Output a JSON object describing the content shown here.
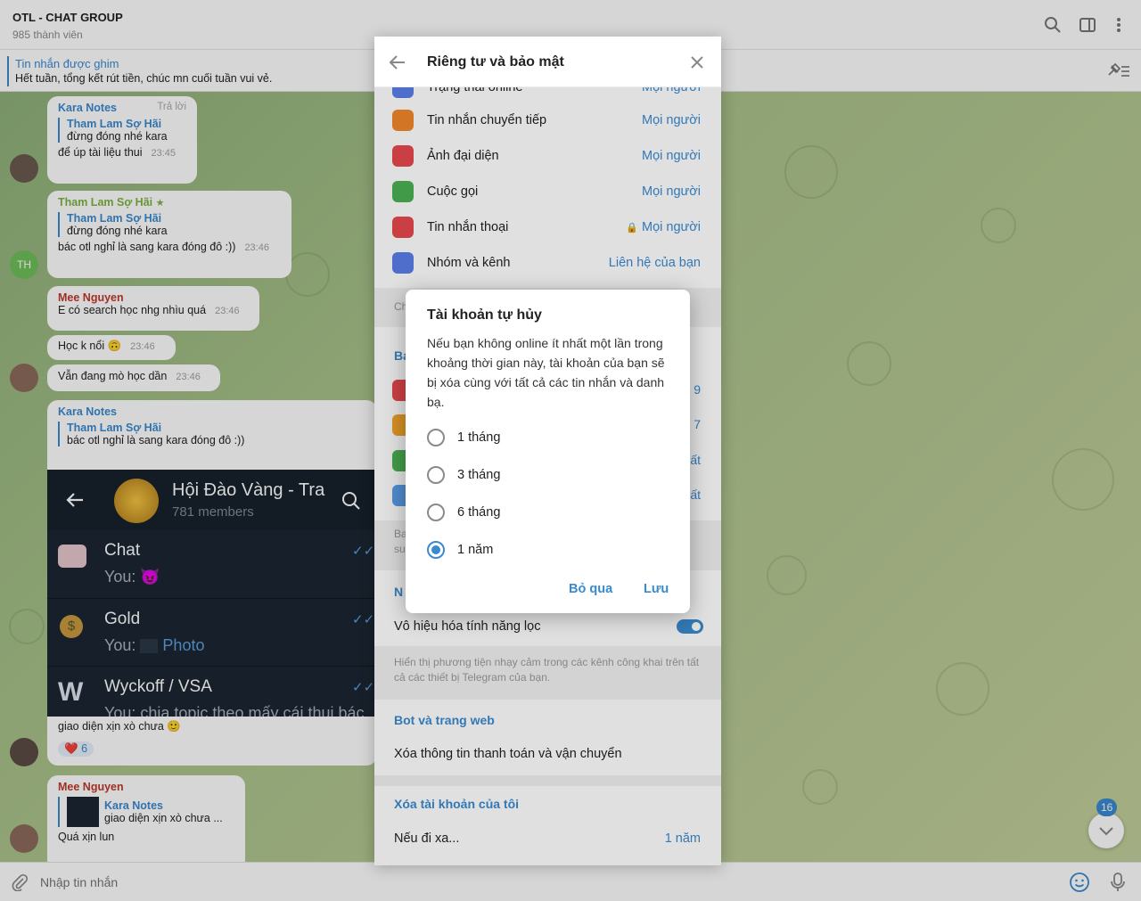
{
  "header": {
    "title": "OTL - CHAT GROUP",
    "subtitle": "985 thành viên"
  },
  "pinned": {
    "title": "Tin nhắn được ghim",
    "text": "Hết tuần, tổng kết rút tiền, chúc mn cuối tuần vui vẻ."
  },
  "messages": {
    "m1": {
      "sender": "Kara Notes",
      "reply_label": "Trả lời",
      "quote_name": "Tham Lam Sợ Hãi",
      "quote_text": "đừng đóng nhé kara",
      "text": "để úp tài liệu thui",
      "time": "23:45"
    },
    "m2": {
      "sender": "Tham Lam Sợ Hãi",
      "star": "★",
      "quote_name": "Tham Lam Sợ Hãi",
      "quote_text": "đừng đóng nhé kara",
      "text": "bác otl nghỉ là sang kara đóng đô :))",
      "time": "23:46",
      "avatar": "TH"
    },
    "m3": {
      "sender": "Mee Nguyen",
      "text": "E có search học nhg nhìu quá",
      "time": "23:46"
    },
    "m4": {
      "text": "Học k nổi 🙃",
      "time": "23:46"
    },
    "m5": {
      "text": "Vẫn đang mò học dần",
      "time": "23:46"
    },
    "m6": {
      "sender": "Kara Notes",
      "quote_name": "Tham Lam Sợ Hãi",
      "quote_text": "bác otl nghỉ là sang kara đóng đô :))",
      "caption": "giao diện xịn xò chưa 🙂",
      "reaction": "❤️",
      "reaction_count": "6"
    },
    "m7": {
      "sender": "Mee Nguyen",
      "quote_name": "Kara Notes",
      "quote_text": "giao diện xịn xò chưa ...",
      "text": "Quá xịn lun"
    }
  },
  "embed": {
    "title": "Hội Đào Vàng - Tra",
    "members": "781 members",
    "chats": [
      {
        "name": "Chat",
        "preview": "You: 😈"
      },
      {
        "name": "Gold",
        "preview_prefix": "You:",
        "preview_link": "Photo"
      },
      {
        "name": "Wyckoff / VSA",
        "preview": "You: chia topic theo mấy cái thui bác"
      }
    ]
  },
  "panel": {
    "title": "Riêng tư và bảo mật",
    "partial_row": {
      "label": "Trạng thái online",
      "value": "Mọi người"
    },
    "rows": [
      {
        "label": "Tin nhắn chuyển tiếp",
        "value": "Mọi người",
        "color": "#f0872b"
      },
      {
        "label": "Ảnh đại diện",
        "value": "Mọi người",
        "color": "#e5484d"
      },
      {
        "label": "Cuộc gọi",
        "value": "Mọi người",
        "color": "#4bb052"
      },
      {
        "label": "Tin nhắn thoại",
        "value": "Mọi người",
        "color": "#e5484d"
      },
      {
        "label": "Nhóm và kênh",
        "value": "Liên hệ của bạn",
        "color": "#5b7de6"
      }
    ],
    "hidden_partial": {
      "a": "Ch",
      "b": "Ba",
      "c": "Ba",
      "d": "su",
      "e": "N",
      "v1": "9",
      "v2": "7",
      "v3": "ất",
      "v4": "ất"
    },
    "filter_toggle": {
      "label": "Vô hiệu hóa tính năng lọc",
      "on": true
    },
    "filter_desc": "Hiển thị phương tiện nhạy cảm trong các kênh công khai trên tất cả các thiết bị Telegram của bạn.",
    "bots_header": "Bot và trang web",
    "bots_row": "Xóa thông tin thanh toán và vận chuyển",
    "delete_header": "Xóa tài khoản của tôi",
    "delete_row": {
      "label": "Nếu đi xa...",
      "value": "1 năm"
    }
  },
  "modal": {
    "title": "Tài khoản tự hủy",
    "body": "Nếu bạn không online ít nhất một lần trong khoảng thời gian này, tài khoản của bạn sẽ bị xóa cùng với tất cả các tin nhắn và danh bạ.",
    "options": [
      "1 tháng",
      "3 tháng",
      "6 tháng",
      "1 năm"
    ],
    "selected_index": 3,
    "cancel": "Bỏ qua",
    "save": "Lưu"
  },
  "footer": {
    "placeholder": "Nhập tin nhắn"
  },
  "scroll_badge": "16",
  "colors": {
    "accent": "#3a8ad0",
    "kara": "#3a8ad0",
    "tham": "#7cb342",
    "mee": "#c0392b"
  }
}
